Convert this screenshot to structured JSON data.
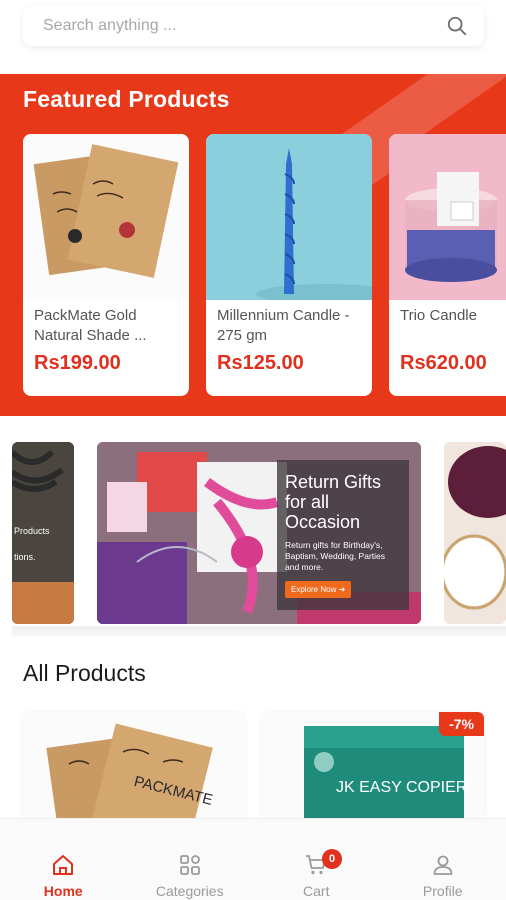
{
  "search": {
    "placeholder": "Search anything ..."
  },
  "featured": {
    "title": "Featured Products",
    "items": [
      {
        "name": "PackMate Gold Natural Shade ...",
        "price": "Rs199.00"
      },
      {
        "name": "Millennium Candle - 275 gm",
        "price": "Rs125.00"
      },
      {
        "name": "Trio Candle",
        "price": "Rs620.00"
      }
    ]
  },
  "banners": {
    "left_partial_lines": [
      "Products",
      "tions."
    ],
    "main": {
      "heading": "Return Gifts for all Occasion",
      "subtext": "Return gifts for Birthday's, Baptism, Wedding, Parties and more.",
      "button": "Explore Now ➔"
    }
  },
  "all_products": {
    "title": "All Products",
    "items": [
      {
        "image_text": "PACKMATE"
      },
      {
        "image_text": "JK EASY COPIER",
        "discount": "-7%"
      }
    ]
  },
  "bottom_nav": {
    "items": [
      {
        "label": "Home",
        "icon": "home-icon",
        "active": true
      },
      {
        "label": "Categories",
        "icon": "grid-icon"
      },
      {
        "label": "Cart",
        "icon": "cart-icon",
        "badge": "0"
      },
      {
        "label": "Profile",
        "icon": "user-icon"
      }
    ]
  },
  "colors": {
    "accent": "#e8381a",
    "price": "#e0301e"
  }
}
